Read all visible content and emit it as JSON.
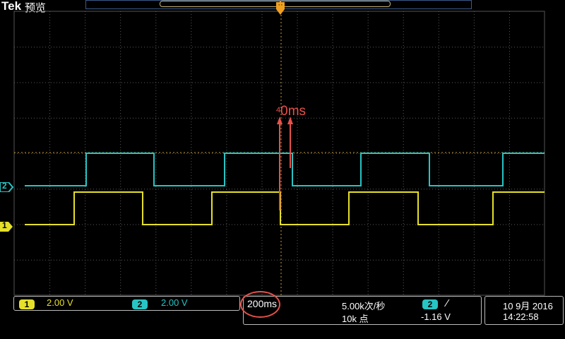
{
  "header": {
    "brand": "Tek",
    "mode": "预览"
  },
  "annotation": {
    "prefix": "4",
    "value": "0ms"
  },
  "channels": [
    {
      "id": "1",
      "label": "1",
      "scale": "2.00 V",
      "color": "#e6e02a"
    },
    {
      "id": "2",
      "label": "2",
      "scale": "2.00 V",
      "color": "#27c4c4"
    }
  ],
  "horizontal": {
    "timebase": "200ms",
    "sample_rate": "5.00k次/秒",
    "record_length": "10k 点"
  },
  "trigger": {
    "source": "2",
    "slope": "⁄",
    "level": "-1.16 V"
  },
  "datetime": {
    "date": "10 9月 2016",
    "time": "14:22:58"
  },
  "colors": {
    "grid": "#4a4a4a",
    "ch1": "#e6e02a",
    "ch2": "#27c4c4",
    "annotation": "#e8504a",
    "trigger_marker": "#f0a020"
  }
}
